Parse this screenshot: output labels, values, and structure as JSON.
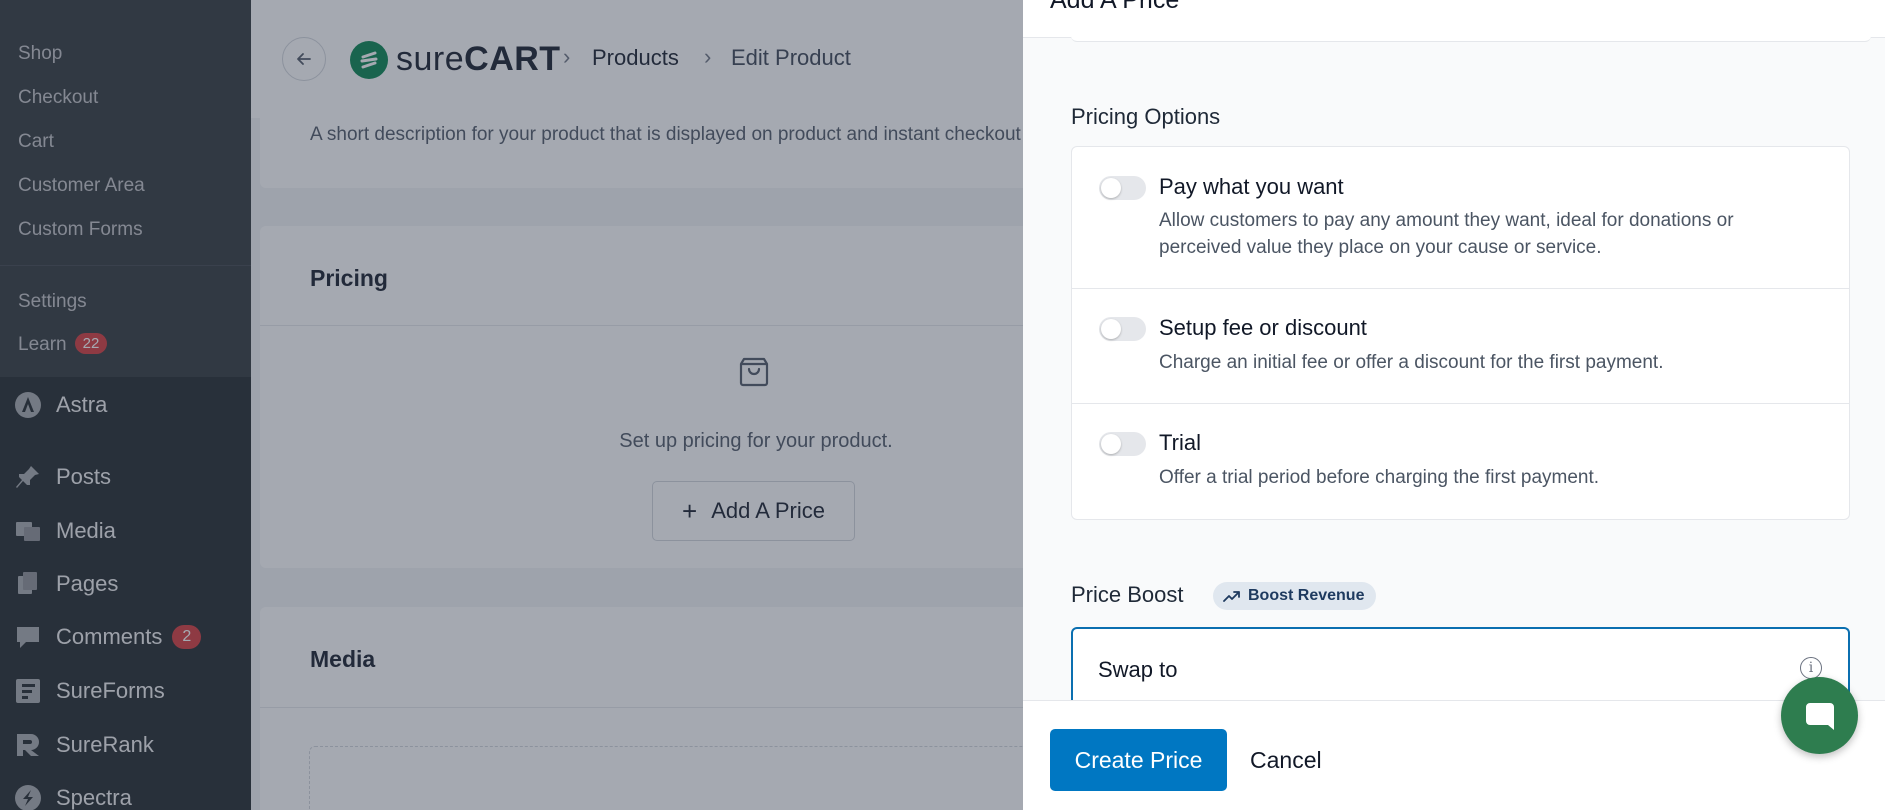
{
  "sidebar": {
    "submenu": [
      "Shop",
      "Checkout",
      "Cart",
      "Customer Area",
      "Custom Forms"
    ],
    "settings_label": "Settings",
    "learn_label": "Learn",
    "learn_badge": "22",
    "menu": [
      {
        "label": "Astra",
        "icon": "astra-icon"
      },
      {
        "label": "Posts",
        "icon": "pushpin-icon"
      },
      {
        "label": "Media",
        "icon": "media-icon"
      },
      {
        "label": "Pages",
        "icon": "pages-icon"
      },
      {
        "label": "Comments",
        "icon": "comment-icon",
        "badge": "2"
      },
      {
        "label": "SureForms",
        "icon": "sureforms-icon"
      },
      {
        "label": "SureRank",
        "icon": "surerank-icon"
      },
      {
        "label": "Spectra",
        "icon": "spectra-icon"
      }
    ]
  },
  "header": {
    "logo_light": "sure",
    "logo_bold": "CART",
    "breadcrumb": [
      "Products",
      "Edit Product"
    ]
  },
  "main": {
    "description_hint": "A short description for your product that is displayed on product and instant checkout pages.",
    "pricing_title": "Pricing",
    "pricing_empty": "Set up pricing for your product.",
    "add_price_label": "Add A Price",
    "media_title": "Media"
  },
  "drawer": {
    "title": "Add A Price",
    "pricing_options_label": "Pricing Options",
    "options": [
      {
        "title": "Pay what you want",
        "desc": "Allow customers to pay any amount they want, ideal for donations or perceived value they place on your cause or service.",
        "enabled": false
      },
      {
        "title": "Setup fee or discount",
        "desc": "Charge an initial fee or offer a discount for the first payment.",
        "enabled": false
      },
      {
        "title": "Trial",
        "desc": "Offer a trial period before charging the first payment.",
        "enabled": false
      }
    ],
    "price_boost_label": "Price Boost",
    "boost_badge": "Boost Revenue",
    "swap_label": "Swap to",
    "create_label": "Create Price",
    "cancel_label": "Cancel"
  },
  "colors": {
    "primary": "#0077c2",
    "brand_green": "#01824c",
    "chat_green": "#2e7d4f",
    "badge_red": "#d63638"
  }
}
